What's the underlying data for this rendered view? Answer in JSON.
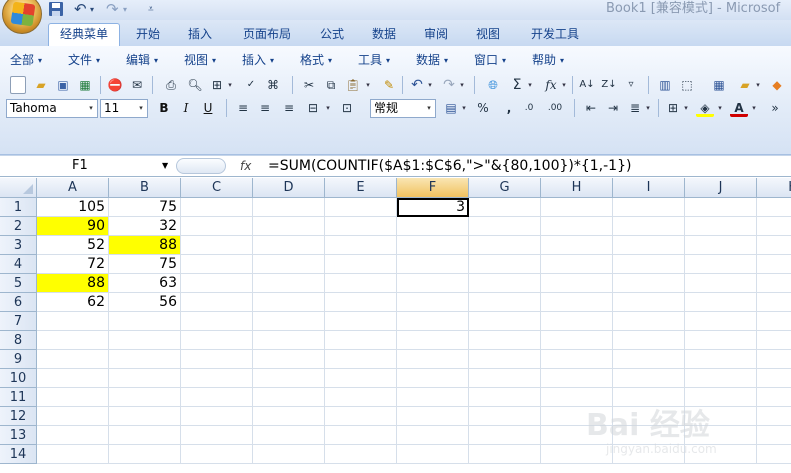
{
  "window": {
    "title": "Book1  [兼容模式] - Microsof"
  },
  "tabs": [
    "经典菜单",
    "开始",
    "插入",
    "页面布局",
    "公式",
    "数据",
    "审阅",
    "视图",
    "开发工具"
  ],
  "menus": [
    "全部",
    "文件",
    "编辑",
    "视图",
    "插入",
    "格式",
    "工具",
    "数据",
    "窗口",
    "帮助"
  ],
  "toolbar": {
    "font_name": "Tahoma",
    "font_size": "11",
    "number_format": "常规",
    "bold": "B",
    "italic": "I",
    "underline": "U",
    "sum": "Σ",
    "fx": "fx",
    "percent": "%",
    "comma": ","
  },
  "formula_bar": {
    "name_box": "F1",
    "fx_label": "fx",
    "formula": "=SUM(COUNTIF($A$1:$C$6,\">\"&{80,100})*{1,-1})"
  },
  "sheet": {
    "columns": [
      "A",
      "B",
      "C",
      "D",
      "E",
      "F",
      "G",
      "H",
      "I",
      "J",
      "K"
    ],
    "rows": [
      "1",
      "2",
      "3",
      "4",
      "5",
      "6",
      "7",
      "8",
      "9",
      "10",
      "11",
      "12",
      "13",
      "14"
    ],
    "cells": {
      "A1": "105",
      "B1": "75",
      "F1": "3",
      "A2": "90",
      "B2": "32",
      "A3": "52",
      "B3": "88",
      "A4": "72",
      "B4": "75",
      "A5": "88",
      "B5": "63",
      "A6": "62",
      "B6": "56"
    },
    "highlight_color": "#ffff00",
    "highlighted_cells": [
      "A2",
      "B3",
      "A5"
    ],
    "active_cell": "F1"
  },
  "watermark": {
    "main": "Bai 经验",
    "sub": "jingyan.baidu.com"
  }
}
